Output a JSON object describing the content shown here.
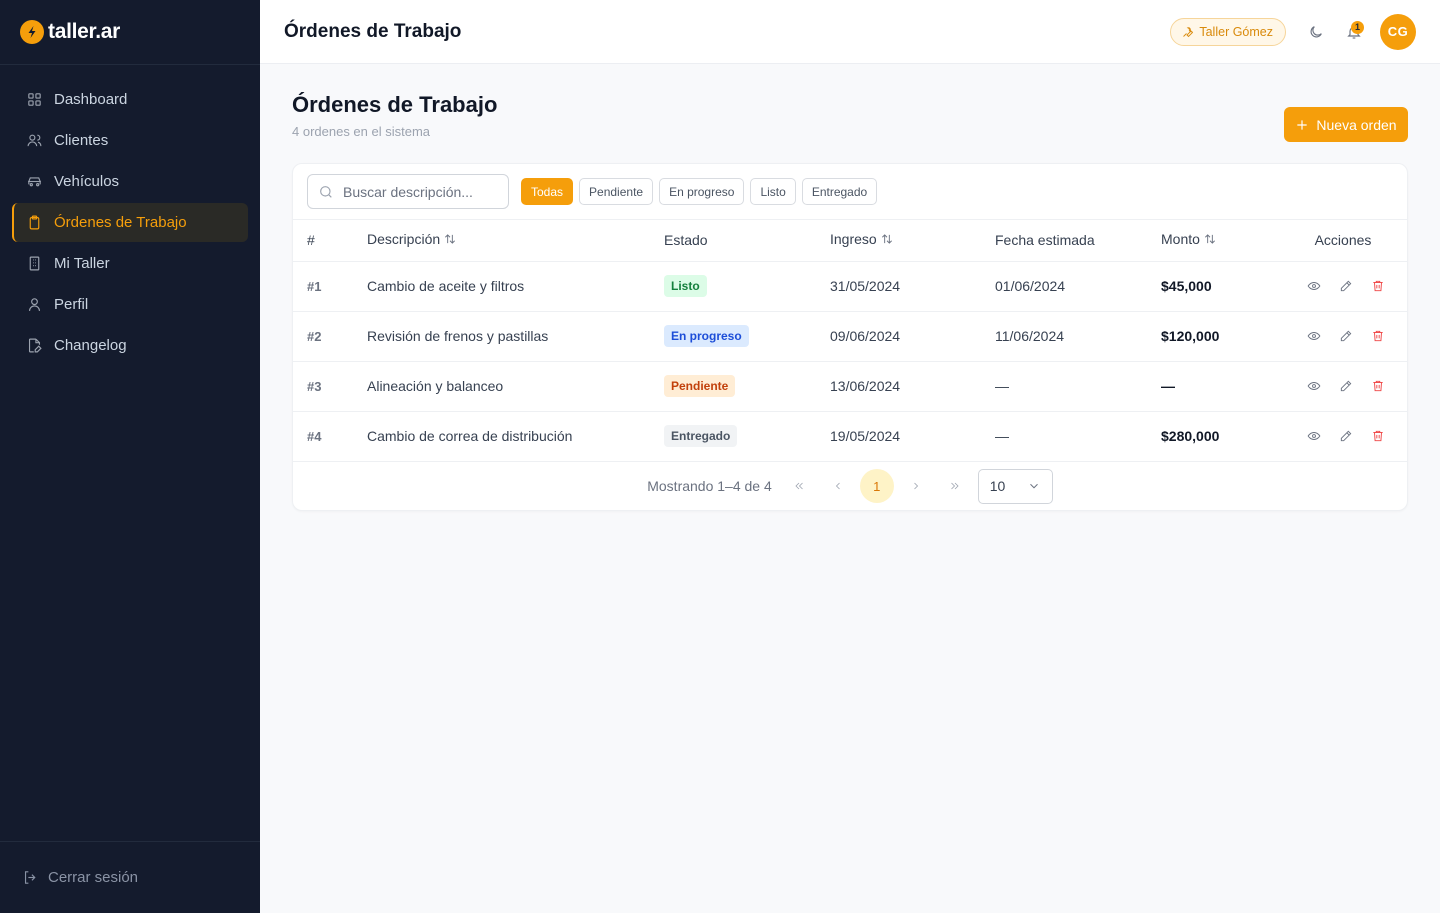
{
  "app": {
    "name": "taller.ar"
  },
  "sidebar": {
    "items": [
      {
        "label": "Dashboard",
        "icon": "grid-icon"
      },
      {
        "label": "Clientes",
        "icon": "users-icon"
      },
      {
        "label": "Vehículos",
        "icon": "car-icon"
      },
      {
        "label": "Órdenes de Trabajo",
        "icon": "clipboard-icon",
        "active": true
      },
      {
        "label": "Mi Taller",
        "icon": "building-icon"
      },
      {
        "label": "Perfil",
        "icon": "user-icon"
      },
      {
        "label": "Changelog",
        "icon": "file-edit-icon"
      }
    ],
    "logout_label": "Cerrar sesión"
  },
  "topbar": {
    "title": "Órdenes de Trabajo",
    "shop_label": "Taller Gómez",
    "notification_count": "1",
    "avatar_initials": "CG"
  },
  "page": {
    "title": "Órdenes de Trabajo",
    "subtitle": "4 ordenes en el sistema",
    "new_button": "Nueva orden"
  },
  "search": {
    "placeholder": "Buscar descripción..."
  },
  "filters": [
    "Todas",
    "Pendiente",
    "En progreso",
    "Listo",
    "Entregado"
  ],
  "active_filter": "Todas",
  "table": {
    "headers": {
      "num": "#",
      "descripcion": "Descripción",
      "estado": "Estado",
      "ingreso": "Ingreso",
      "fecha": "Fecha estimada",
      "monto": "Monto",
      "acciones": "Acciones"
    },
    "rows": [
      {
        "num": "#1",
        "descripcion": "Cambio de aceite y filtros",
        "estado": "Listo",
        "ingreso": "31/05/2024",
        "fecha": "01/06/2024",
        "monto": "$45,000"
      },
      {
        "num": "#2",
        "descripcion": "Revisión de frenos y pastillas",
        "estado": "En progreso",
        "ingreso": "09/06/2024",
        "fecha": "11/06/2024",
        "monto": "$120,000"
      },
      {
        "num": "#3",
        "descripcion": "Alineación y balanceo",
        "estado": "Pendiente",
        "ingreso": "13/06/2024",
        "fecha": "—",
        "monto": "—"
      },
      {
        "num": "#4",
        "descripcion": "Cambio de correa de distribución",
        "estado": "Entregado",
        "ingreso": "19/05/2024",
        "fecha": "—",
        "monto": "$280,000"
      }
    ]
  },
  "status_colors": {
    "Listo": {
      "bg": "#dcfce7",
      "fg": "#15803d"
    },
    "En progreso": {
      "bg": "#dbeafe",
      "fg": "#1d4ed8"
    },
    "Pendiente": {
      "bg": "#ffedd5",
      "fg": "#c2410c"
    },
    "Entregado": {
      "bg": "#f1f3f5",
      "fg": "#4b5563"
    }
  },
  "pagination": {
    "info": "Mostrando 1–4 de 4",
    "current_page": "1",
    "page_size": "10"
  },
  "colors": {
    "accent": "#f59e0b",
    "sidebar_bg": "#141b2d",
    "danger": "#ef4444"
  }
}
